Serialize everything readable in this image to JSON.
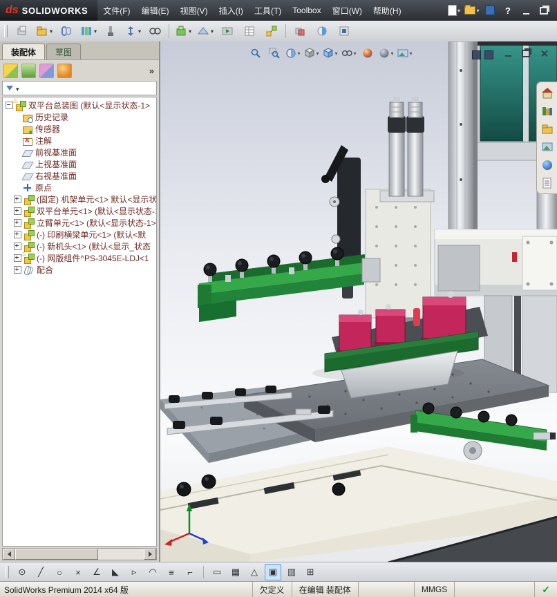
{
  "colors": {
    "accent_green": "#35a84a",
    "mid_green": "#22843a",
    "dark_green": "#1c6b2e",
    "teal_panel": "#1f6f66",
    "magenta": "#c2265a",
    "platform_gray": "#7d8288",
    "base_ivory": "#f1efe5",
    "tree_text": "#6e2a24",
    "status_check_green": "#1d9e27",
    "warning_yellow": "#f2b705"
  },
  "title_bar": {
    "brand_mark": "ds",
    "brand_name": "SOLIDWORKS",
    "menu": [
      "文件(F)",
      "编辑(E)",
      "视图(V)",
      "插入(I)",
      "工具(T)",
      "Toolbox",
      "窗口(W)",
      "帮助(H)"
    ]
  },
  "left_panel": {
    "tabs": [
      {
        "label": "装配体"
      },
      {
        "label": "草图"
      }
    ],
    "overflow_chevron": "»",
    "tree": {
      "items": [
        {
          "label": "双平台总装图 (默认<显示状态-1>",
          "icon": "assembly",
          "warning": true
        },
        {
          "label": "历史记录",
          "icon": "history-folder"
        },
        {
          "label": "传感器",
          "icon": "sensors-folder"
        },
        {
          "label": "注解",
          "icon": "annotations-folder"
        },
        {
          "label": "前视基准面",
          "icon": "plane"
        },
        {
          "label": "上视基准面",
          "icon": "plane"
        },
        {
          "label": "右视基准面",
          "icon": "plane"
        },
        {
          "label": "原点",
          "icon": "origin"
        },
        {
          "label": "(固定) 机架单元<1> 默认<显示状",
          "icon": "component"
        },
        {
          "label": "双平台单元<1> (默认<显示状态-1",
          "icon": "component"
        },
        {
          "label": "立臂单元<1> (默认<显示状态-1>)",
          "icon": "component"
        },
        {
          "label": "(-) 印刷横梁单元<1> (默认<默",
          "icon": "component"
        },
        {
          "label": "(-) 新机头<1> (默认<显示_状态",
          "icon": "component"
        },
        {
          "label": "(-) 网版组件^PS-3045E-LDJ<1",
          "icon": "component",
          "warning": true
        },
        {
          "label": "配合",
          "icon": "mates"
        }
      ]
    }
  },
  "bottom_toolbar": {
    "tools": [
      {
        "glyph": "⊙",
        "name": "point"
      },
      {
        "glyph": "╱",
        "name": "line"
      },
      {
        "glyph": "○",
        "name": "circle"
      },
      {
        "glyph": "×",
        "name": "delete"
      },
      {
        "glyph": "∠",
        "name": "angle-dimension"
      },
      {
        "glyph": "◣",
        "name": "fillet"
      },
      {
        "glyph": "▹",
        "name": "convert-entities"
      },
      {
        "glyph": "◠",
        "name": "arc"
      },
      {
        "glyph": "≡",
        "name": "centerline"
      },
      {
        "glyph": "⌐",
        "name": "offset"
      },
      {
        "glyph": "▭",
        "name": "rectangle"
      },
      {
        "glyph": "▦",
        "name": "grid"
      },
      {
        "glyph": "△",
        "name": "polygon"
      },
      {
        "glyph": "▣",
        "name": "shaded-view",
        "active": true
      },
      {
        "glyph": "▥",
        "name": "wireframe-view"
      },
      {
        "glyph": "⊞",
        "name": "section-grid"
      }
    ]
  },
  "status_bar": {
    "app_name": "SolidWorks Premium 2014 x64 版",
    "definition_state": "欠定义",
    "edit_state": "在编辑 装配体",
    "units": "MMGS",
    "check_glyph": "✓"
  }
}
